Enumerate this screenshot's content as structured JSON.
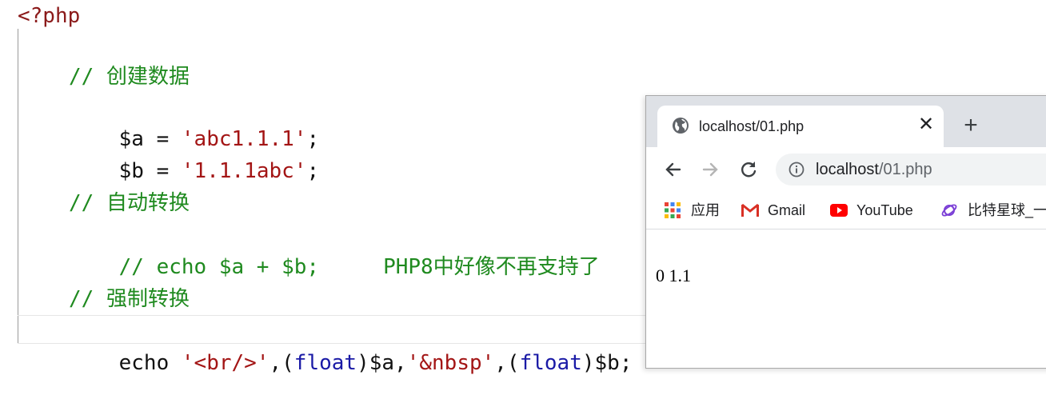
{
  "editor": {
    "open_tag": "<?php",
    "comment_create": "// 创建数据",
    "line_a": {
      "var": "$a",
      "eq": " = ",
      "str": "'abc1.1.1'",
      "end": ";"
    },
    "line_b": {
      "var": "$b",
      "eq": " = ",
      "str": "'1.1.1abc'",
      "end": ";"
    },
    "comment_auto": "// 自动转换",
    "comment_echo": "// echo $a + $b;",
    "comment_php8": "PHP8中好像不再支持了",
    "comment_force": "// 强制转换",
    "echo_line": {
      "kw": "echo ",
      "s1": "'<br/>'",
      "p1": ",(",
      "cast1": "float",
      "p2": ")$a,",
      "s2": "'&nbsp'",
      "p3": ",(",
      "cast2": "float",
      "p4": ")$b;"
    },
    "colors": {
      "comment": "#1f8a1f",
      "string": "#a31515",
      "keyword": "#1a1aa6",
      "php_tag": "#8b1a1a"
    }
  },
  "browser": {
    "tab": {
      "title": "localhost/01.php",
      "icon": "globe-icon",
      "close": "✕"
    },
    "new_tab": "+",
    "address": {
      "host": "localhost",
      "path": "/01.php",
      "icon": "info-icon"
    },
    "bookmarks": [
      {
        "label": "应用",
        "icon": "apps-grid-icon"
      },
      {
        "label": "Gmail",
        "icon": "gmail-icon"
      },
      {
        "label": "YouTube",
        "icon": "youtube-icon"
      },
      {
        "label": "比特星球_一",
        "icon": "bitplanet-icon"
      }
    ],
    "page_output": "0 1.1"
  }
}
